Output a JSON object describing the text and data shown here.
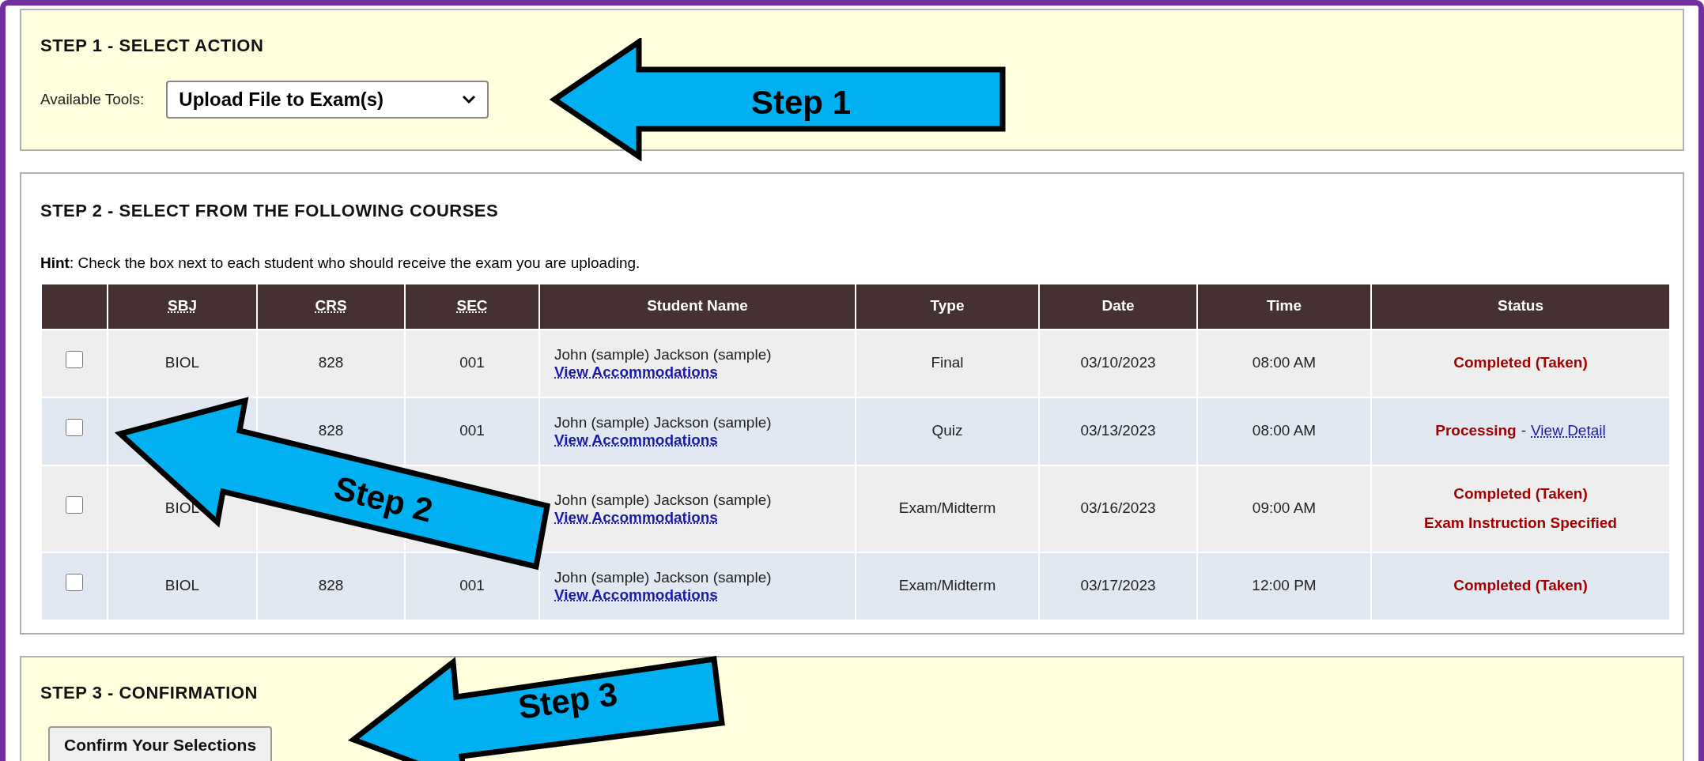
{
  "step1": {
    "heading": "STEP 1 - SELECT ACTION",
    "label": "Available Tools:",
    "select_value": "Upload File to Exam(s)"
  },
  "step2": {
    "heading": "STEP 2 - SELECT FROM THE FOLLOWING COURSES",
    "hint": "**Hint**: Check the box next to each student who should receive the exam you are uploading.",
    "columns": [
      {
        "label": "SBJ",
        "abbr": true
      },
      {
        "label": "CRS",
        "abbr": true
      },
      {
        "label": "SEC",
        "abbr": true
      },
      {
        "label": "Student Name",
        "abbr": false
      },
      {
        "label": "Type",
        "abbr": false
      },
      {
        "label": "Date",
        "abbr": false
      },
      {
        "label": "Time",
        "abbr": false
      },
      {
        "label": "Status",
        "abbr": false
      }
    ],
    "rows": [
      {
        "checked": false,
        "sbj": "BIOL",
        "crs": "828",
        "sec": "001",
        "student": "John (sample) Jackson (sample)",
        "link": "View Accommodations",
        "type": "Final",
        "date": "03/10/2023",
        "time": "08:00 AM",
        "status_lines": [
          [
            {
              "kind": "status",
              "text": "Completed (Taken)"
            }
          ]
        ]
      },
      {
        "checked": false,
        "crs": "828",
        "sec": "001",
        "student": "John (sample) Jackson (sample)",
        "link": "View Accommodations",
        "type": "Quiz",
        "date": "03/13/2023",
        "time": "08:00 AM",
        "status_lines": [
          [
            {
              "kind": "status",
              "text": "Processing"
            },
            {
              "kind": "separator",
              "text": "-"
            },
            {
              "kind": "link",
              "text": "View Detail"
            }
          ]
        ]
      },
      {
        "checked": false,
        "sbj": "BIOL",
        "student": "John (sample) Jackson (sample)",
        "link": "View Accommodations",
        "type": "Exam/Midterm",
        "date": "03/16/2023",
        "time": "09:00 AM",
        "status_lines": [
          [
            {
              "kind": "status",
              "text": "Completed (Taken)"
            }
          ],
          [
            {
              "kind": "status",
              "text": "Exam Instruction Specified"
            }
          ]
        ]
      },
      {
        "checked": false,
        "sbj": "BIOL",
        "crs": "828",
        "sec": "001",
        "student": "John (sample) Jackson (sample)",
        "link": "View Accommodations",
        "type": "Exam/Midterm",
        "date": "03/17/2023",
        "time": "12:00 PM",
        "status_lines": [
          [
            {
              "kind": "status",
              "text": "Completed (Taken)"
            }
          ]
        ]
      }
    ]
  },
  "step3": {
    "heading": "STEP 3 - CONFIRMATION",
    "button": "Confirm Your Selections"
  },
  "callouts": [
    {
      "label": "Step 1"
    },
    {
      "label": "Step 2"
    },
    {
      "label": "Step 3"
    }
  ]
}
